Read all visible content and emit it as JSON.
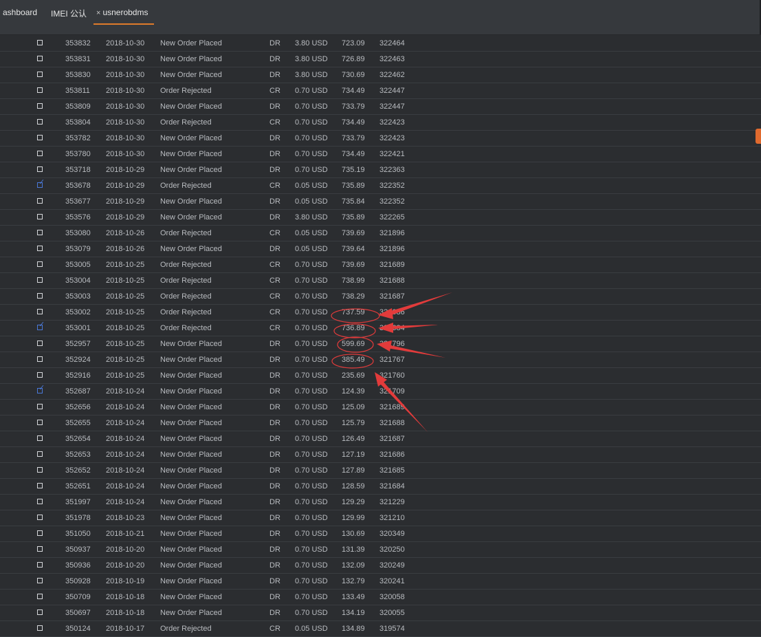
{
  "tabs": [
    {
      "label": "ashboard"
    },
    {
      "label": "IMEI 公认"
    },
    {
      "label": "usnerobdms",
      "close": "×",
      "active": true
    }
  ],
  "colors": {
    "accent": "#e07b2a",
    "annotation": "#e23b3b",
    "checked": "#4a79d9"
  },
  "rows": [
    {
      "checked": false,
      "id": "353832",
      "date": "2018-10-30",
      "desc": "New Order Placed",
      "type": "DR",
      "amount": "3.80 USD",
      "balance": "723.09",
      "ref": "322464"
    },
    {
      "checked": false,
      "id": "353831",
      "date": "2018-10-30",
      "desc": "New Order Placed",
      "type": "DR",
      "amount": "3.80 USD",
      "balance": "726.89",
      "ref": "322463"
    },
    {
      "checked": false,
      "id": "353830",
      "date": "2018-10-30",
      "desc": "New Order Placed",
      "type": "DR",
      "amount": "3.80 USD",
      "balance": "730.69",
      "ref": "322462"
    },
    {
      "checked": false,
      "id": "353811",
      "date": "2018-10-30",
      "desc": "Order Rejected",
      "type": "CR",
      "amount": "0.70 USD",
      "balance": "734.49",
      "ref": "322447"
    },
    {
      "checked": false,
      "id": "353809",
      "date": "2018-10-30",
      "desc": "New Order Placed",
      "type": "DR",
      "amount": "0.70 USD",
      "balance": "733.79",
      "ref": "322447"
    },
    {
      "checked": false,
      "id": "353804",
      "date": "2018-10-30",
      "desc": "Order Rejected",
      "type": "CR",
      "amount": "0.70 USD",
      "balance": "734.49",
      "ref": "322423"
    },
    {
      "checked": false,
      "id": "353782",
      "date": "2018-10-30",
      "desc": "New Order Placed",
      "type": "DR",
      "amount": "0.70 USD",
      "balance": "733.79",
      "ref": "322423"
    },
    {
      "checked": false,
      "id": "353780",
      "date": "2018-10-30",
      "desc": "New Order Placed",
      "type": "DR",
      "amount": "0.70 USD",
      "balance": "734.49",
      "ref": "322421"
    },
    {
      "checked": false,
      "id": "353718",
      "date": "2018-10-29",
      "desc": "New Order Placed",
      "type": "DR",
      "amount": "0.70 USD",
      "balance": "735.19",
      "ref": "322363"
    },
    {
      "checked": true,
      "id": "353678",
      "date": "2018-10-29",
      "desc": "Order Rejected",
      "type": "CR",
      "amount": "0.05 USD",
      "balance": "735.89",
      "ref": "322352"
    },
    {
      "checked": false,
      "id": "353677",
      "date": "2018-10-29",
      "desc": "New Order Placed",
      "type": "DR",
      "amount": "0.05 USD",
      "balance": "735.84",
      "ref": "322352"
    },
    {
      "checked": false,
      "id": "353576",
      "date": "2018-10-29",
      "desc": "New Order Placed",
      "type": "DR",
      "amount": "3.80 USD",
      "balance": "735.89",
      "ref": "322265"
    },
    {
      "checked": false,
      "id": "353080",
      "date": "2018-10-26",
      "desc": "Order Rejected",
      "type": "CR",
      "amount": "0.05 USD",
      "balance": "739.69",
      "ref": "321896"
    },
    {
      "checked": false,
      "id": "353079",
      "date": "2018-10-26",
      "desc": "New Order Placed",
      "type": "DR",
      "amount": "0.05 USD",
      "balance": "739.64",
      "ref": "321896"
    },
    {
      "checked": false,
      "id": "353005",
      "date": "2018-10-25",
      "desc": "Order Rejected",
      "type": "CR",
      "amount": "0.70 USD",
      "balance": "739.69",
      "ref": "321689"
    },
    {
      "checked": false,
      "id": "353004",
      "date": "2018-10-25",
      "desc": "Order Rejected",
      "type": "CR",
      "amount": "0.70 USD",
      "balance": "738.99",
      "ref": "321688"
    },
    {
      "checked": false,
      "id": "353003",
      "date": "2018-10-25",
      "desc": "Order Rejected",
      "type": "CR",
      "amount": "0.70 USD",
      "balance": "738.29",
      "ref": "321687"
    },
    {
      "checked": false,
      "id": "353002",
      "date": "2018-10-25",
      "desc": "Order Rejected",
      "type": "CR",
      "amount": "0.70 USD",
      "balance": "737.59",
      "ref": "321686"
    },
    {
      "checked": true,
      "id": "353001",
      "date": "2018-10-25",
      "desc": "Order Rejected",
      "type": "CR",
      "amount": "0.70 USD",
      "balance": "736.89",
      "ref": "321684"
    },
    {
      "checked": false,
      "id": "352957",
      "date": "2018-10-25",
      "desc": "New Order Placed",
      "type": "DR",
      "amount": "0.70 USD",
      "balance": "599.69",
      "ref": "321796"
    },
    {
      "checked": false,
      "id": "352924",
      "date": "2018-10-25",
      "desc": "New Order Placed",
      "type": "DR",
      "amount": "0.70 USD",
      "balance": "385.49",
      "ref": "321767"
    },
    {
      "checked": false,
      "id": "352916",
      "date": "2018-10-25",
      "desc": "New Order Placed",
      "type": "DR",
      "amount": "0.70 USD",
      "balance": "235.69",
      "ref": "321760"
    },
    {
      "checked": true,
      "id": "352687",
      "date": "2018-10-24",
      "desc": "New Order Placed",
      "type": "DR",
      "amount": "0.70 USD",
      "balance": "124.39",
      "ref": "321709"
    },
    {
      "checked": false,
      "id": "352656",
      "date": "2018-10-24",
      "desc": "New Order Placed",
      "type": "DR",
      "amount": "0.70 USD",
      "balance": "125.09",
      "ref": "321689"
    },
    {
      "checked": false,
      "id": "352655",
      "date": "2018-10-24",
      "desc": "New Order Placed",
      "type": "DR",
      "amount": "0.70 USD",
      "balance": "125.79",
      "ref": "321688"
    },
    {
      "checked": false,
      "id": "352654",
      "date": "2018-10-24",
      "desc": "New Order Placed",
      "type": "DR",
      "amount": "0.70 USD",
      "balance": "126.49",
      "ref": "321687"
    },
    {
      "checked": false,
      "id": "352653",
      "date": "2018-10-24",
      "desc": "New Order Placed",
      "type": "DR",
      "amount": "0.70 USD",
      "balance": "127.19",
      "ref": "321686"
    },
    {
      "checked": false,
      "id": "352652",
      "date": "2018-10-24",
      "desc": "New Order Placed",
      "type": "DR",
      "amount": "0.70 USD",
      "balance": "127.89",
      "ref": "321685"
    },
    {
      "checked": false,
      "id": "352651",
      "date": "2018-10-24",
      "desc": "New Order Placed",
      "type": "DR",
      "amount": "0.70 USD",
      "balance": "128.59",
      "ref": "321684"
    },
    {
      "checked": false,
      "id": "351997",
      "date": "2018-10-24",
      "desc": "New Order Placed",
      "type": "DR",
      "amount": "0.70 USD",
      "balance": "129.29",
      "ref": "321229"
    },
    {
      "checked": false,
      "id": "351978",
      "date": "2018-10-23",
      "desc": "New Order Placed",
      "type": "DR",
      "amount": "0.70 USD",
      "balance": "129.99",
      "ref": "321210"
    },
    {
      "checked": false,
      "id": "351050",
      "date": "2018-10-21",
      "desc": "New Order Placed",
      "type": "DR",
      "amount": "0.70 USD",
      "balance": "130.69",
      "ref": "320349"
    },
    {
      "checked": false,
      "id": "350937",
      "date": "2018-10-20",
      "desc": "New Order Placed",
      "type": "DR",
      "amount": "0.70 USD",
      "balance": "131.39",
      "ref": "320250"
    },
    {
      "checked": false,
      "id": "350936",
      "date": "2018-10-20",
      "desc": "New Order Placed",
      "type": "DR",
      "amount": "0.70 USD",
      "balance": "132.09",
      "ref": "320249"
    },
    {
      "checked": false,
      "id": "350928",
      "date": "2018-10-19",
      "desc": "New Order Placed",
      "type": "DR",
      "amount": "0.70 USD",
      "balance": "132.79",
      "ref": "320241"
    },
    {
      "checked": false,
      "id": "350709",
      "date": "2018-10-18",
      "desc": "New Order Placed",
      "type": "DR",
      "amount": "0.70 USD",
      "balance": "133.49",
      "ref": "320058"
    },
    {
      "checked": false,
      "id": "350697",
      "date": "2018-10-18",
      "desc": "New Order Placed",
      "type": "DR",
      "amount": "0.70 USD",
      "balance": "134.19",
      "ref": "320055"
    },
    {
      "checked": false,
      "id": "350124",
      "date": "2018-10-17",
      "desc": "Order Rejected",
      "type": "CR",
      "amount": "0.05 USD",
      "balance": "134.89",
      "ref": "319574"
    }
  ]
}
